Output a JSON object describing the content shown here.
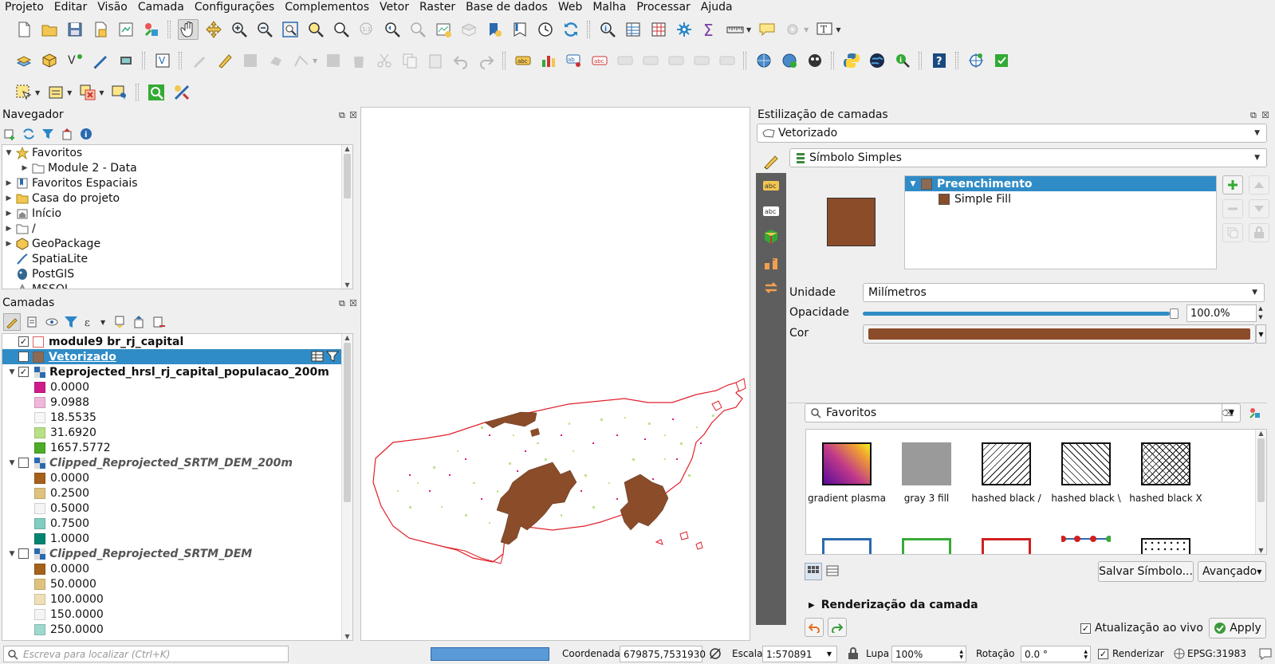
{
  "menu": [
    "Projeto",
    "Editar",
    "Visão",
    "Camada",
    "Configurações",
    "Complementos",
    "Vetor",
    "Raster",
    "Base de dados",
    "Web",
    "Malha",
    "Processar",
    "Ajuda"
  ],
  "navigator": {
    "title": "Navegador",
    "items": [
      {
        "label": "Favoritos",
        "icon": "star-icon",
        "expanded": true
      },
      {
        "label": "Module 2 - Data",
        "icon": "folder-icon",
        "child": true
      },
      {
        "label": "Favoritos Espaciais",
        "icon": "spatial-bookmark-icon"
      },
      {
        "label": "Casa do projeto",
        "icon": "project-home-icon"
      },
      {
        "label": "Início",
        "icon": "home-folder-icon"
      },
      {
        "label": "/",
        "icon": "folder-icon"
      },
      {
        "label": "GeoPackage",
        "icon": "geopackage-icon"
      },
      {
        "label": "SpatiaLite",
        "icon": "spatialite-icon"
      },
      {
        "label": "PostGIS",
        "icon": "postgis-icon"
      },
      {
        "label": "MSSQL",
        "icon": "mssql-icon"
      }
    ]
  },
  "layers": {
    "title": "Camadas",
    "l1": "module9 br_rj_capital",
    "l2": "Vetorizado",
    "l3": "Reprojected_hrsl_rj_capital_populacao_200m",
    "l3_legend": [
      {
        "label": "0.0000",
        "color": "#d01c8b"
      },
      {
        "label": "9.0988",
        "color": "#f1b6da"
      },
      {
        "label": "18.5535",
        "color": "#f7f7f7"
      },
      {
        "label": "31.6920",
        "color": "#b8e186"
      },
      {
        "label": "1657.5772",
        "color": "#4dac26"
      }
    ],
    "l4": "Clipped_Reprojected_SRTM_DEM_200m",
    "l4_legend": [
      {
        "label": "0.0000",
        "color": "#a6611a"
      },
      {
        "label": "0.2500",
        "color": "#dfc27d"
      },
      {
        "label": "0.5000",
        "color": "#f5f5f5"
      },
      {
        "label": "0.7500",
        "color": "#80cdc1"
      },
      {
        "label": "1.0000",
        "color": "#018571"
      }
    ],
    "l5": "Clipped_Reprojected_SRTM_DEM",
    "l5_legend": [
      {
        "label": "0.0000",
        "color": "#a6611a"
      },
      {
        "label": "50.0000",
        "color": "#dfc27d"
      },
      {
        "label": "100.0000",
        "color": "#f0e0b8"
      },
      {
        "label": "150.0000",
        "color": "#f5f5f5"
      },
      {
        "label": "250.0000",
        "color": "#9fd8cf"
      }
    ]
  },
  "styling": {
    "title": "Estilização de camadas",
    "layer_select": "Vetorizado",
    "renderer": "Símbolo Simples",
    "symbol_tree": {
      "root": "Preenchimento",
      "child": "Simple Fill"
    },
    "fill_color": "#8b4c2a",
    "unit_label": "Unidade",
    "unit_value": "Milímetros",
    "opacity_label": "Opacidade",
    "opacity_value": "100.0%",
    "opacity_fraction": 1.0,
    "color_label": "Cor",
    "search_value": "Favoritos",
    "symbols": [
      {
        "name": "gradient plasma"
      },
      {
        "name": "gray 3 fill"
      },
      {
        "name": "hashed black /"
      },
      {
        "name": "hashed black \\"
      },
      {
        "name": "hashed black X"
      }
    ],
    "save_symbol": "Salvar Símbolo...",
    "advanced": "Avançado",
    "render_section": "Renderização da camada",
    "live_update": "Atualização ao vivo",
    "apply": "Apply"
  },
  "statusbar": {
    "locate_placeholder": "Escreva para localizar (Ctrl+K)",
    "coord_label": "Coordenada",
    "coord_value": "679875,7531930",
    "scale_label": "Escala",
    "scale_value": "1:570891",
    "magnifier_label": "Lupa",
    "magnifier_value": "100%",
    "rotation_label": "Rotação",
    "rotation_value": "0.0 °",
    "render_label": "Renderizar",
    "crs": "EPSG:31983"
  }
}
